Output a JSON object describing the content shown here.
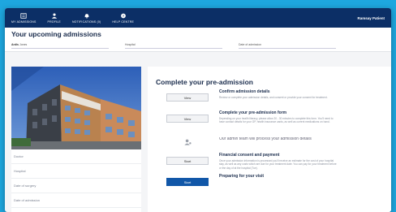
{
  "nav": {
    "items": [
      {
        "label": "MY ADMISSIONS",
        "icon": "admissions-icon"
      },
      {
        "label": "PROFILE",
        "icon": "person-icon"
      },
      {
        "label": "NOTIFICATIONS (0)",
        "icon": "bell-icon"
      },
      {
        "label": "HELP CENTRE",
        "icon": "help-icon"
      }
    ],
    "user": "Ramsay Patient"
  },
  "header": {
    "title": "Your upcoming admissions",
    "filters": [
      {
        "label": "Ardis",
        "value": "Jones"
      },
      {
        "label": "Hospital",
        "value": ""
      },
      {
        "label": "Date of admission",
        "value": ""
      }
    ]
  },
  "side": {
    "rows": [
      "Doctor",
      "Hospital",
      "Date of surgery",
      "Date of admission"
    ]
  },
  "main": {
    "title": "Complete your pre-admission",
    "steps": [
      {
        "button": "View",
        "title": "Confirm admission details",
        "lines": [
          "Review or complete your admission details, and consent or provide your consent for treatment."
        ]
      },
      {
        "button": "View",
        "title": "Complete your pre-admission form",
        "lines": [
          "Depending on your health literacy, please allow 20 - 30 minutes to complete this form. You'll need to",
          "have contact details for your GP, health insurance cards, as well as current medications on hand."
        ]
      },
      {
        "button": "",
        "title": "",
        "lines": [
          "Our admin team will process your admission details"
        ]
      },
      {
        "button": "Start",
        "title": "Financial consent and payment",
        "lines": [
          "Once your admission information is processed you'll receive an estimate for the cost of your hospital",
          "stay, as well as any costs which are due for your treatment date. You can pay for your treatment before",
          "or the day of at the hospital (Tue)."
        ]
      },
      {
        "button": "Start",
        "title": "Preparing for your visit",
        "lines": [
          ""
        ]
      }
    ]
  }
}
